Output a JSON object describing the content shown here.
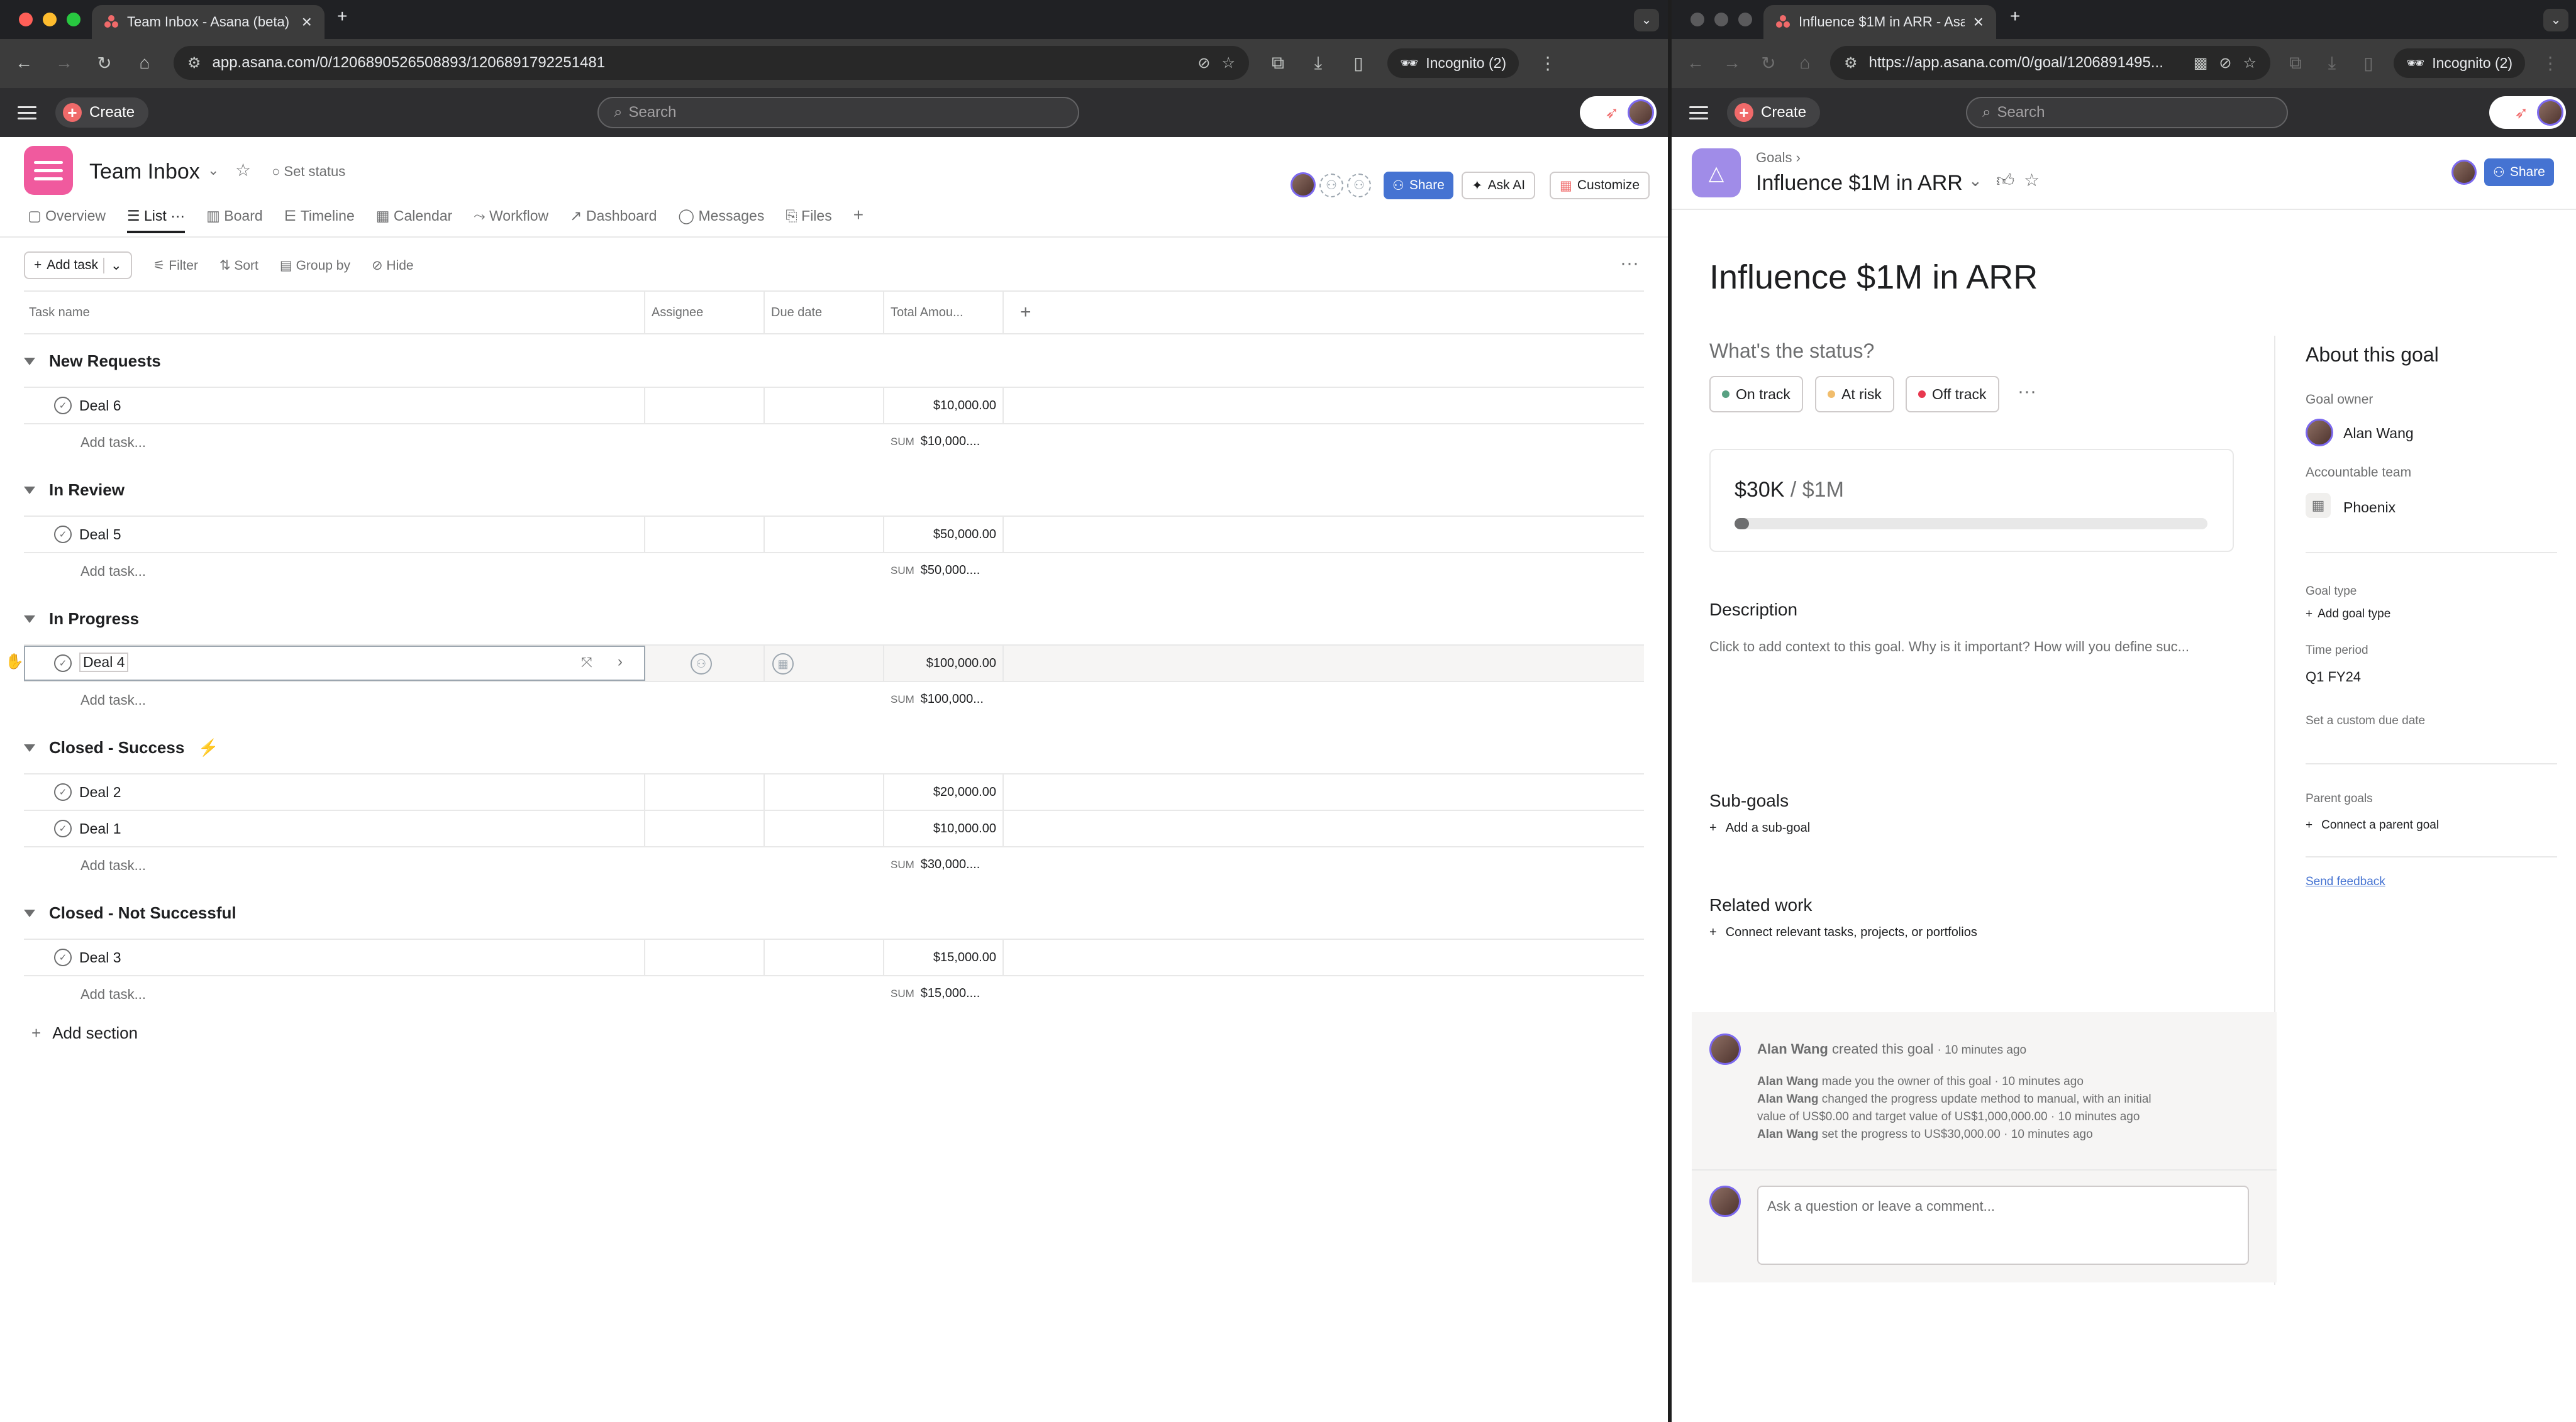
{
  "colors": {
    "brand_red": "#f06a6a",
    "project_pink": "#f05a9e",
    "goal_purple": "#a08ce8",
    "share_blue": "#4573d2",
    "on_track": "#58a182",
    "at_risk": "#f1bd6c",
    "off_track": "#e8384f"
  },
  "left_window": {
    "tab_title": "Team Inbox - Asana (beta)",
    "url": "app.asana.com/0/1206890526508893/1206891792251481",
    "incognito": "Incognito (2)",
    "create": "Create",
    "search_placeholder": "Search",
    "project": {
      "title": "Team Inbox",
      "set_status": "Set status",
      "share": "Share",
      "ask_ai": "Ask AI",
      "customize": "Customize"
    },
    "tabs": [
      "Overview",
      "List",
      "Board",
      "Timeline",
      "Calendar",
      "Workflow",
      "Dashboard",
      "Messages",
      "Files"
    ],
    "toolbar": {
      "add_task": "Add task",
      "filter": "Filter",
      "sort": "Sort",
      "group_by": "Group by",
      "hide": "Hide"
    },
    "columns": {
      "task_name": "Task name",
      "assignee": "Assignee",
      "due_date": "Due date",
      "total_amount": "Total Amou..."
    },
    "add_task_row": "Add task...",
    "sum_label": "SUM",
    "sections": [
      {
        "name": "New Requests",
        "tasks": [
          {
            "name": "Deal 6",
            "amount": "$10,000.00"
          }
        ],
        "sum": "$10,000...."
      },
      {
        "name": "In Review",
        "tasks": [
          {
            "name": "Deal 5",
            "amount": "$50,000.00"
          }
        ],
        "sum": "$50,000...."
      },
      {
        "name": "In Progress",
        "tasks": [
          {
            "name": "Deal 4",
            "amount": "$100,000.00"
          }
        ],
        "sum": "$100,000..."
      },
      {
        "name": "Closed - Success",
        "tasks": [
          {
            "name": "Deal 2",
            "amount": "$20,000.00"
          },
          {
            "name": "Deal 1",
            "amount": "$10,000.00"
          }
        ],
        "sum": "$30,000...."
      },
      {
        "name": "Closed - Not Successful",
        "tasks": [
          {
            "name": "Deal 3",
            "amount": "$15,000.00"
          }
        ],
        "sum": "$15,000...."
      }
    ],
    "add_section": "Add section"
  },
  "right_window": {
    "tab_title": "Influence $1M in ARR - Asa",
    "url": "https://app.asana.com/0/goal/1206891495...",
    "incognito": "Incognito (2)",
    "create": "Create",
    "search_placeholder": "Search",
    "breadcrumb": "Goals",
    "goal_title": "Influence $1M in ARR",
    "share": "Share",
    "heading": "Influence $1M in ARR",
    "status_question": "What's the status?",
    "status_options": [
      "On track",
      "At risk",
      "Off track"
    ],
    "progress": {
      "current": "$30K",
      "separator": "/",
      "target": "$1M",
      "fraction": 0.03
    },
    "description_heading": "Description",
    "description_placeholder": "Click to add context to this goal. Why is it important? How will you define suc...",
    "subgoals_heading": "Sub-goals",
    "add_subgoal": "Add a sub-goal",
    "related_heading": "Related work",
    "connect_related": "Connect relevant tasks, projects, or portfolios",
    "about": {
      "heading": "About this goal",
      "owner_label": "Goal owner",
      "owner": "Alan Wang",
      "team_label": "Accountable team",
      "team": "Phoenix",
      "type_label": "Goal type",
      "add_type": "Add goal type",
      "period_label": "Time period",
      "period": "Q1 FY24",
      "custom_due": "Set a custom due date",
      "parent_label": "Parent goals",
      "connect_parent": "Connect a parent goal",
      "feedback": "Send feedback"
    },
    "activity": {
      "creator": "Alan Wang",
      "created_text": "created this goal",
      "created_time": "· 10 minutes ago",
      "lines": [
        {
          "who": "Alan Wang",
          "text": "made you the owner of this goal · 10 minutes ago"
        },
        {
          "who": "Alan Wang",
          "text": "changed the progress update method to manual, with an initial"
        },
        {
          "who": "",
          "text": "value of US$0.00 and target value of US$1,000,000.00 · 10 minutes ago"
        },
        {
          "who": "Alan Wang",
          "text": "set the progress to US$30,000.00 · 10 minutes ago"
        }
      ],
      "comment_placeholder": "Ask a question or leave a comment..."
    }
  }
}
